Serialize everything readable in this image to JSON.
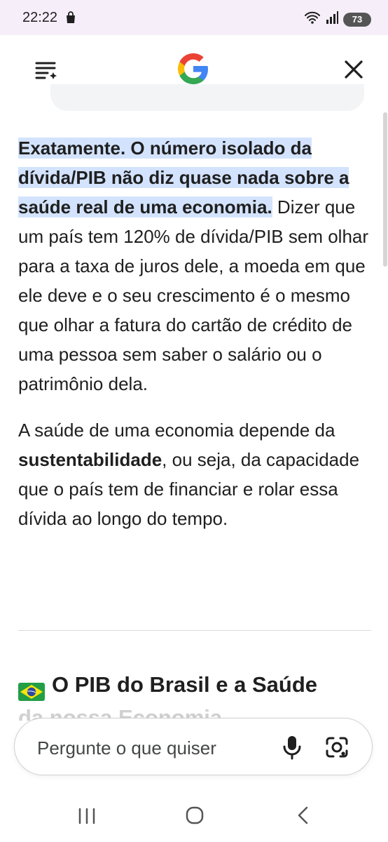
{
  "status_bar": {
    "time": "22:22",
    "battery": "73",
    "network_label": "5"
  },
  "app_bar": {
    "logo_letter": "G"
  },
  "content": {
    "p1_highlight": "Exatamente. O número isolado da dívida/PIB não diz quase nada sobre a saúde real de uma economia.",
    "p1_rest": " Dizer que um país tem 120% de dívida/PIB sem olhar para a taxa de juros dele, a moeda em que ele deve e o seu crescimento é o mesmo que olhar a fatura do cartão de crédito de uma pessoa sem saber o salário ou o patrimônio dela.",
    "p2_start": "A saúde de uma economia depende da ",
    "p2_bold": "sustentabilidade",
    "p2_end": ", ou seja, da capacidade que o país tem de financiar e rolar essa dívida ao longo do tempo.",
    "section_heading": "O PIB do Brasil e a Saúde",
    "section_heading_continuation": "da nossa Economia"
  },
  "input": {
    "placeholder": "Pergunte o que quiser"
  },
  "colors": {
    "highlight": "#d3e3fd",
    "status_bar_bg": "#f6eef9"
  }
}
